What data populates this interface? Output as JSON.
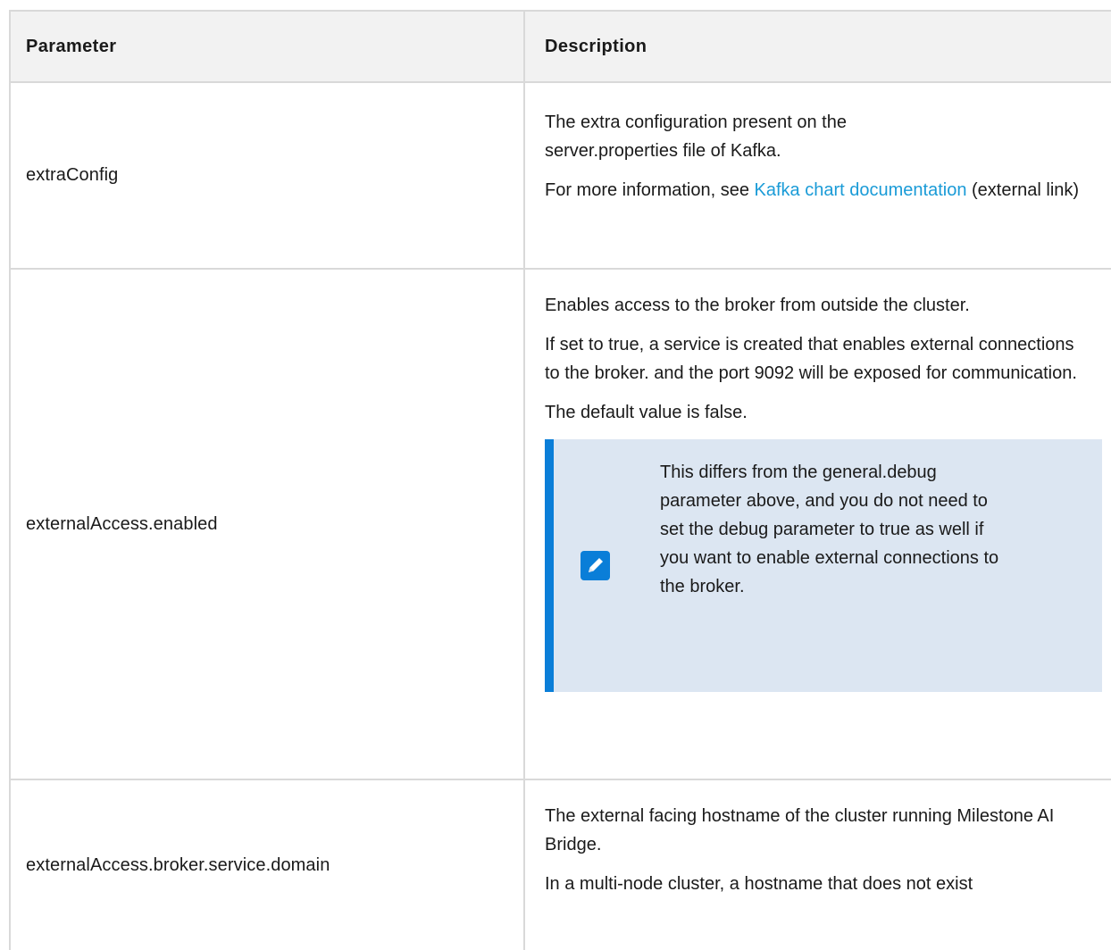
{
  "table": {
    "headers": {
      "parameter": "Parameter",
      "description": "Description"
    },
    "rows": [
      {
        "parameter": "extraConfig",
        "desc_p1": "The extra configuration present on the server.properties file of Kafka.",
        "desc_p2_prefix": "For more information, see ",
        "desc_p2_link": "Kafka chart documentation",
        "desc_p2_suffix": " (external link)"
      },
      {
        "parameter": "externalAccess.enabled",
        "desc_p1": "Enables access to the broker from outside the cluster.",
        "desc_p2": "If set to true, a service is created that enables external connections to the broker. and the port 9092 will be exposed for communication.",
        "desc_p3": "The default value is false.",
        "note": "This differs from the general.debug parameter above, and you do not need to set the debug parameter to true as well if you want to enable external connections to the broker.",
        "note_icon": "pencil-icon"
      },
      {
        "parameter": "externalAccess.broker.service.domain",
        "desc_p1": "The external facing hostname of the cluster running Milestone AI Bridge.",
        "desc_p2": "In a multi-node cluster, a hostname that does not exist"
      }
    ]
  },
  "colors": {
    "link": "#1a9bd7",
    "note_bg": "#dce6f2",
    "note_border": "#0a7ed8",
    "header_bg": "#f2f2f2",
    "grid": "#d9d9d9"
  }
}
